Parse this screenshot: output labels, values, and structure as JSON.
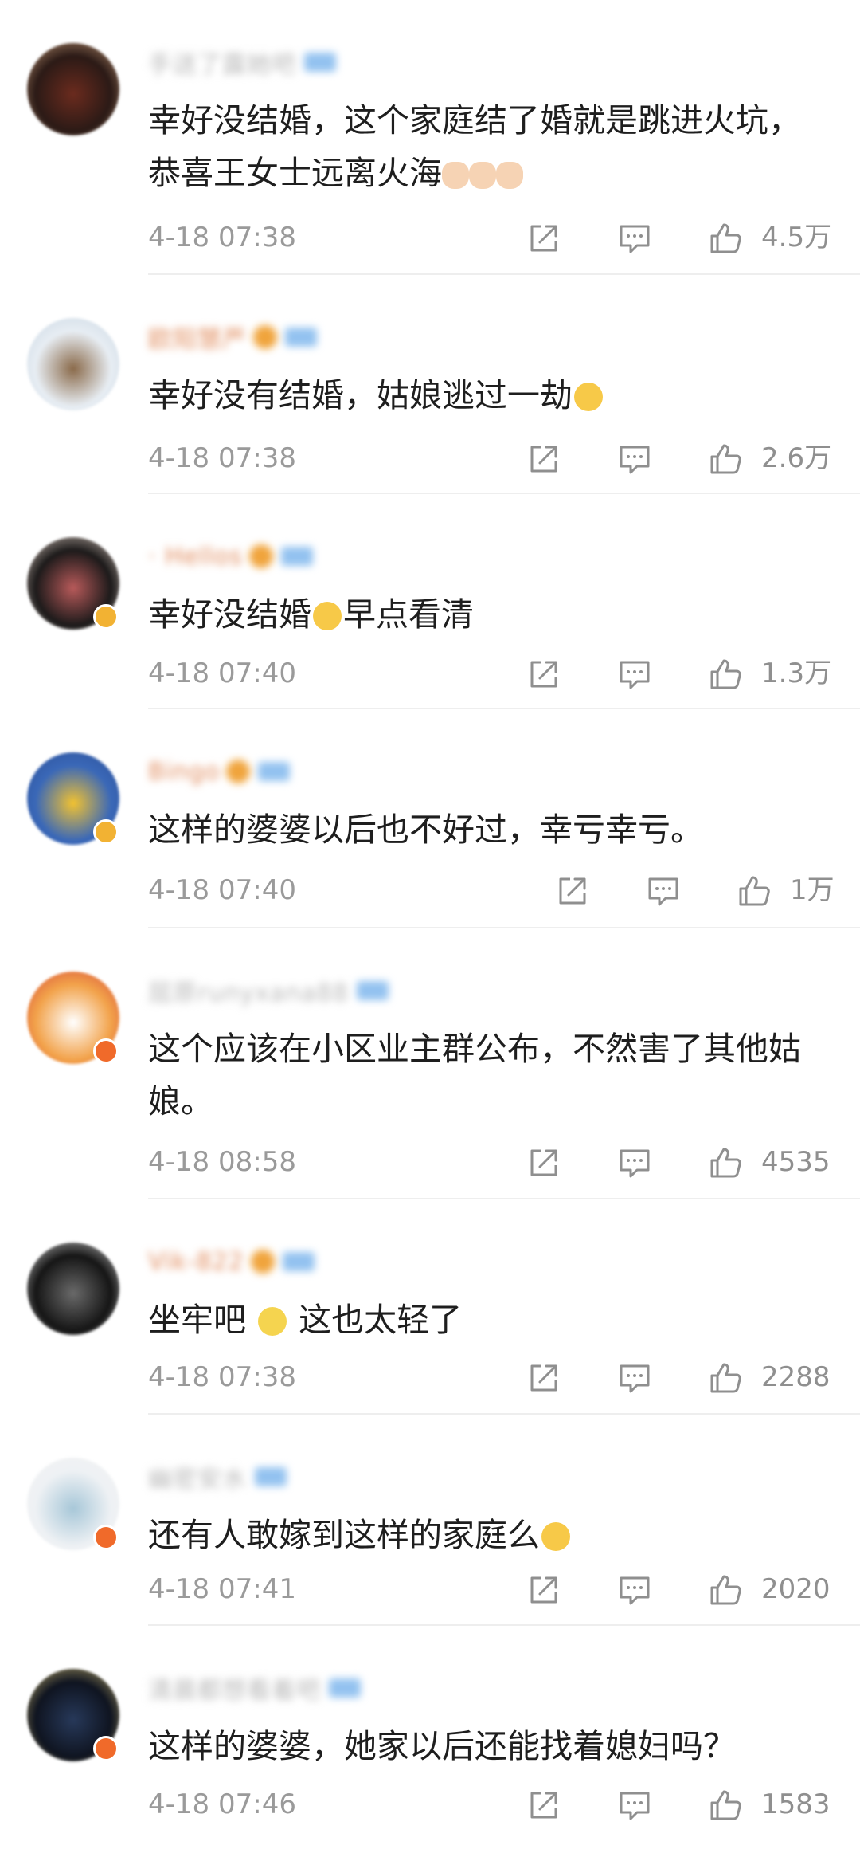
{
  "comments": [
    {
      "username": "手送了露她吧",
      "avatar_colors": [
        "#2b1a16",
        "#6b2b1e",
        "#c59a76"
      ],
      "text": "幸好没结婚，这个家庭结了婚就是跳进火坑，恭喜王女士远离火海",
      "emoji": "clap-clap-clap",
      "time": "4-18 07:38",
      "likes": "4.5万",
      "username_color": "#b8b8b8",
      "has_rank": false,
      "has_badge": false
    },
    {
      "username": "欧阳慧严",
      "avatar_colors": [
        "#e7edf3",
        "#8a6a4a",
        "#c8d6e2"
      ],
      "text": "幸好没有结婚，姑娘逃过一劫",
      "emoji": "laugh-cry",
      "time": "4-18 07:38",
      "likes": "2.6万",
      "username_color": "#e08a5a",
      "has_rank": true,
      "has_badge": false
    },
    {
      "username": "· Hellos",
      "avatar_colors": [
        "#1c1a1a",
        "#b85a5a",
        "#e0cfc4"
      ],
      "text": "幸好没结婚",
      "emoji": "laugh-cry",
      "text_after": "早点看清",
      "time": "4-18 07:40",
      "likes": "1.3万",
      "username_color": "#e0895a",
      "has_rank": true,
      "has_badge": true
    },
    {
      "username": "Bingo",
      "avatar_colors": [
        "#3a68b8",
        "#f2c230",
        "#2c4f96"
      ],
      "text": "这样的婆婆以后也不好过，幸亏幸亏。",
      "emoji": "",
      "time": "4-18 07:40",
      "likes": "1万",
      "username_color": "#e0895a",
      "has_rank": true,
      "has_badge": true
    },
    {
      "username": "屈原runyxana88",
      "avatar_colors": [
        "#f2a24a",
        "#ffffff",
        "#d6483a"
      ],
      "text": "这个应该在小区业主群公布，不然害了其他姑娘。",
      "emoji": "",
      "time": "4-18 08:58",
      "likes": "4535",
      "username_color": "#b8b8b8",
      "has_rank": false,
      "has_badge": true
    },
    {
      "username": "Vik-822",
      "avatar_colors": [
        "#151515",
        "#6a6a6a",
        "#d8d8d8"
      ],
      "text": "坐牢吧 ",
      "emoji": "sad",
      "text_after": " 这也太轻了",
      "time": "4-18 07:38",
      "likes": "2288",
      "username_color": "#e0895a",
      "has_rank": true,
      "has_badge": false
    },
    {
      "username": "幽密安水",
      "avatar_colors": [
        "#eef1f4",
        "#a7c7d8",
        "#f3f3f3"
      ],
      "text": "还有人敢嫁到这样的家庭么",
      "emoji": "laugh-cry",
      "time": "4-18 07:41",
      "likes": "2020",
      "username_color": "#b8b8b8",
      "has_rank": false,
      "has_badge": true
    },
    {
      "username": "清晨都想看着吧",
      "avatar_colors": [
        "#0f1420",
        "#27395a",
        "#c6b36e"
      ],
      "text": "这样的婆婆，她家以后还能找着媳妇吗？",
      "emoji": "",
      "time": "4-18 07:46",
      "likes": "1583",
      "username_color": "#b8b8b8",
      "has_rank": false,
      "has_badge": true
    }
  ],
  "icons": {
    "share": "share-icon",
    "comment": "comment-icon",
    "like": "thumbs-up-icon"
  },
  "colors": {
    "timestamp": "#9a9a9a",
    "text": "#1e1e1e",
    "divider": "#eeeeee",
    "icon": "#8f8f8f"
  }
}
